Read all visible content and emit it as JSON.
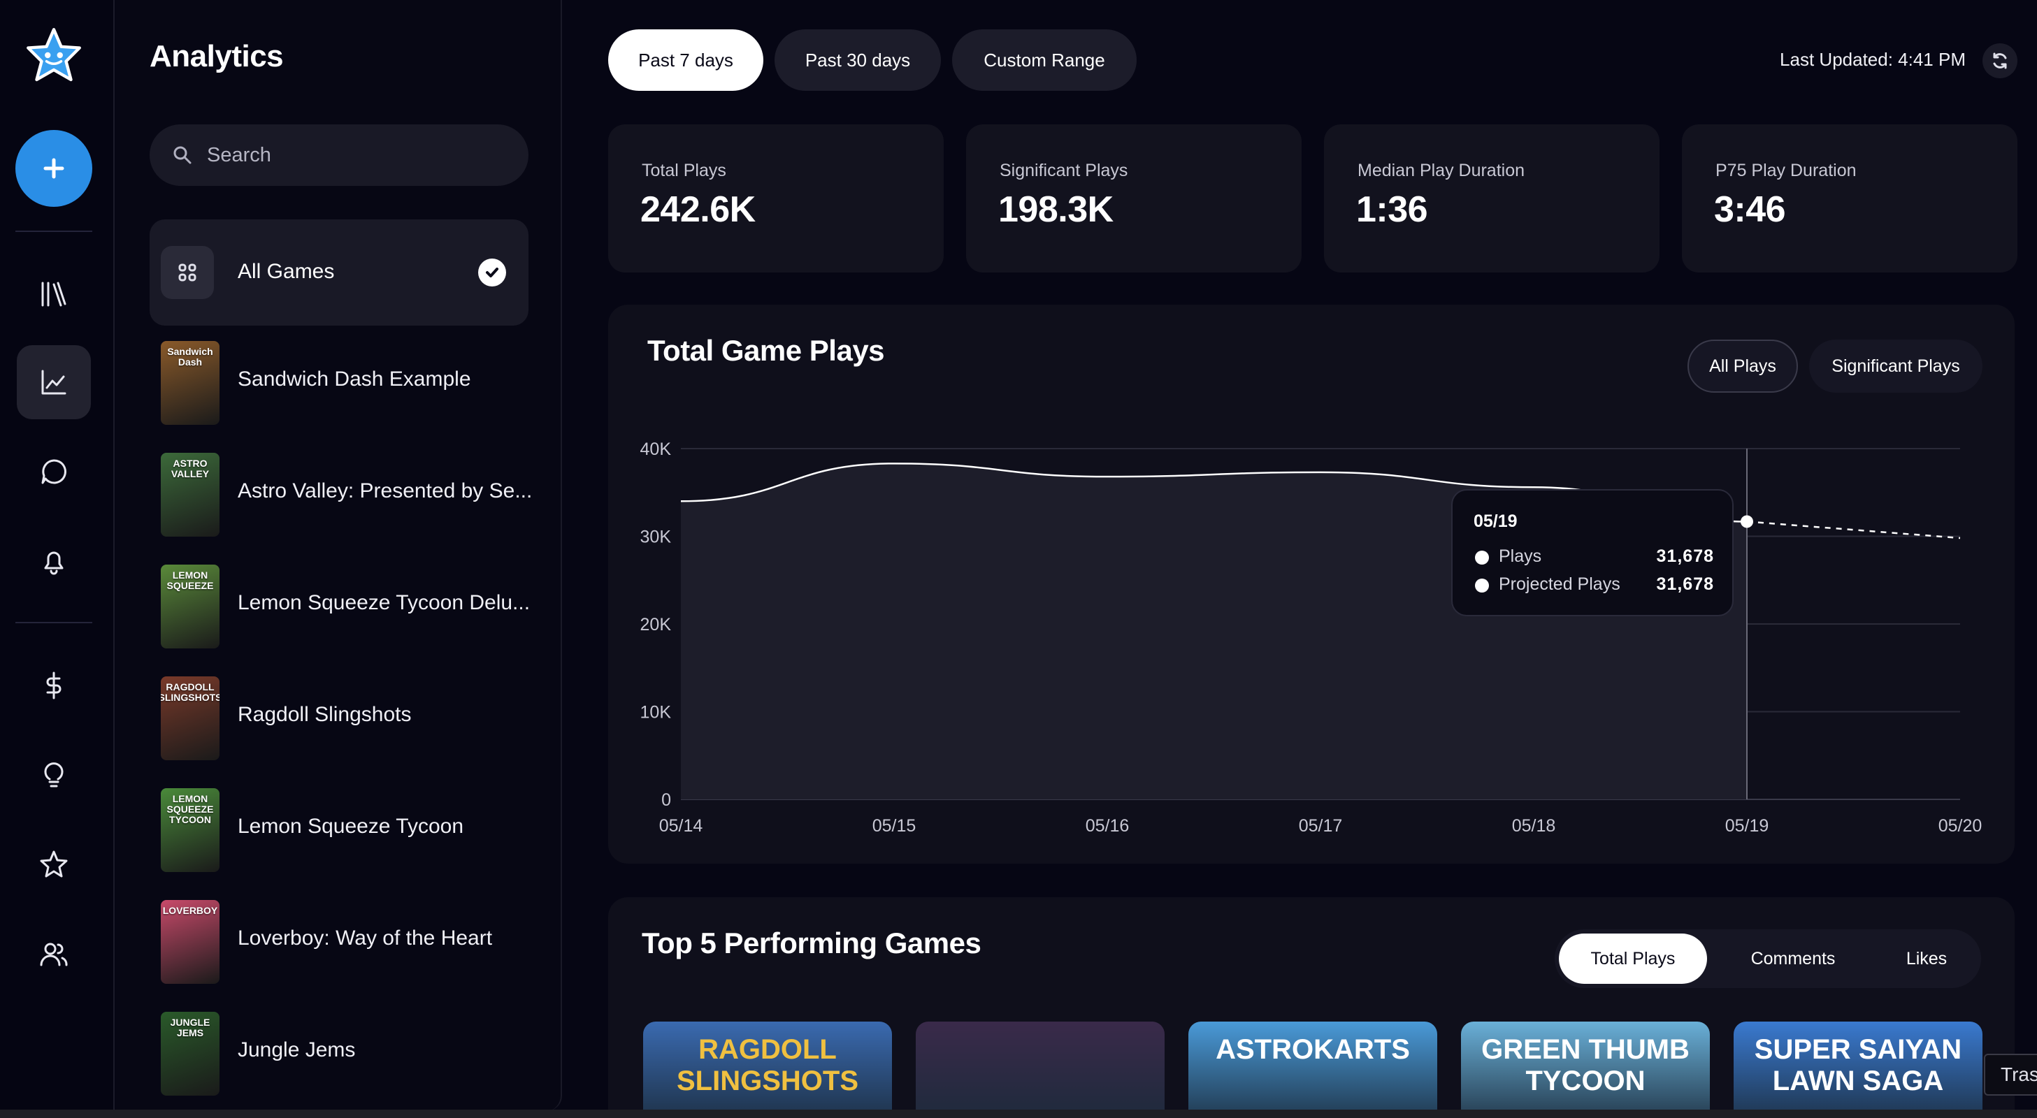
{
  "sidebar": {
    "title": "Analytics",
    "search_placeholder": "Search",
    "all_games_label": "All Games",
    "games": [
      {
        "name": "Sandwich Dash Example",
        "thumb_text": "Sandwich Dash",
        "color": "#8a5a2a"
      },
      {
        "name": "Astro Valley: Presented by Se...",
        "thumb_text": "ASTRO VALLEY",
        "color": "#3c6a3a"
      },
      {
        "name": "Lemon Squeeze Tycoon Delu...",
        "thumb_text": "LEMON SQUEEZE",
        "color": "#5a8a3a"
      },
      {
        "name": "Ragdoll Slingshots",
        "thumb_text": "RAGDOLL SLINGSHOTS",
        "color": "#7a3a2a"
      },
      {
        "name": "Lemon Squeeze Tycoon",
        "thumb_text": "LEMON SQUEEZE TYCOON",
        "color": "#4a8a3a"
      },
      {
        "name": "Loverboy: Way of the Heart",
        "thumb_text": "LOVERBOY",
        "color": "#c84a6a"
      },
      {
        "name": "Jungle Jems",
        "thumb_text": "JUNGLE JEMS",
        "color": "#2a5a2a"
      }
    ]
  },
  "rail": {
    "icons": [
      "logo-star-icon",
      "add-icon",
      "library-icon",
      "analytics-icon",
      "chat-icon",
      "bell-icon",
      "dollar-icon",
      "lightbulb-icon",
      "star-icon",
      "users-icon"
    ],
    "active": "analytics-icon",
    "accent": "#2a8ee6"
  },
  "topbar": {
    "ranges": [
      "Past 7 days",
      "Past 30 days",
      "Custom Range"
    ],
    "active_range": "Past 7 days",
    "last_updated": "Last Updated: 4:41 PM"
  },
  "stats": [
    {
      "label": "Total Plays",
      "value": "242.6K"
    },
    {
      "label": "Significant Plays",
      "value": "198.3K"
    },
    {
      "label": "Median Play Duration",
      "value": "1:36"
    },
    {
      "label": "P75 Play Duration",
      "value": "3:46"
    }
  ],
  "chart": {
    "title": "Total Game Plays",
    "toggles": [
      "All Plays",
      "Significant Plays"
    ],
    "active_toggle": "All Plays",
    "tooltip": {
      "date": "05/19",
      "rows": [
        {
          "label": "Plays",
          "value": "31,678"
        },
        {
          "label": "Projected Plays",
          "value": "31,678"
        }
      ]
    }
  },
  "chart_data": {
    "type": "area",
    "x": [
      "05/14",
      "05/15",
      "05/16",
      "05/17",
      "05/18",
      "05/19",
      "05/20"
    ],
    "series": [
      {
        "name": "Plays",
        "values": [
          34000,
          38300,
          36800,
          37300,
          35600,
          31678
        ]
      },
      {
        "name": "Projected Plays",
        "values": [
          null,
          null,
          null,
          null,
          null,
          31678,
          29800
        ]
      }
    ],
    "yticks": [
      "0",
      "10K",
      "20K",
      "30K",
      "40K"
    ],
    "ylim": [
      0,
      40000
    ],
    "grid": true,
    "highlight_x": "05/19"
  },
  "top5": {
    "title": "Top 5 Performing Games",
    "tabs": [
      "Total Plays",
      "Comments",
      "Likes"
    ],
    "active_tab": "Total Plays",
    "posters": [
      {
        "text": "RAGDOLL SLINGSHOTS",
        "color": "#3a6ab0"
      },
      {
        "text": "",
        "color": "#3a2a4a"
      },
      {
        "text": "ASTROKARTS",
        "color": "#4a9ad8"
      },
      {
        "text": "GREEN THUMB TYCOON",
        "color": "#6ab0d8"
      },
      {
        "text": "SUPER SAIYAN LAWN SAGA",
        "color": "#3a7ad0"
      }
    ]
  },
  "overlay": {
    "trash_hint": "Tras"
  }
}
